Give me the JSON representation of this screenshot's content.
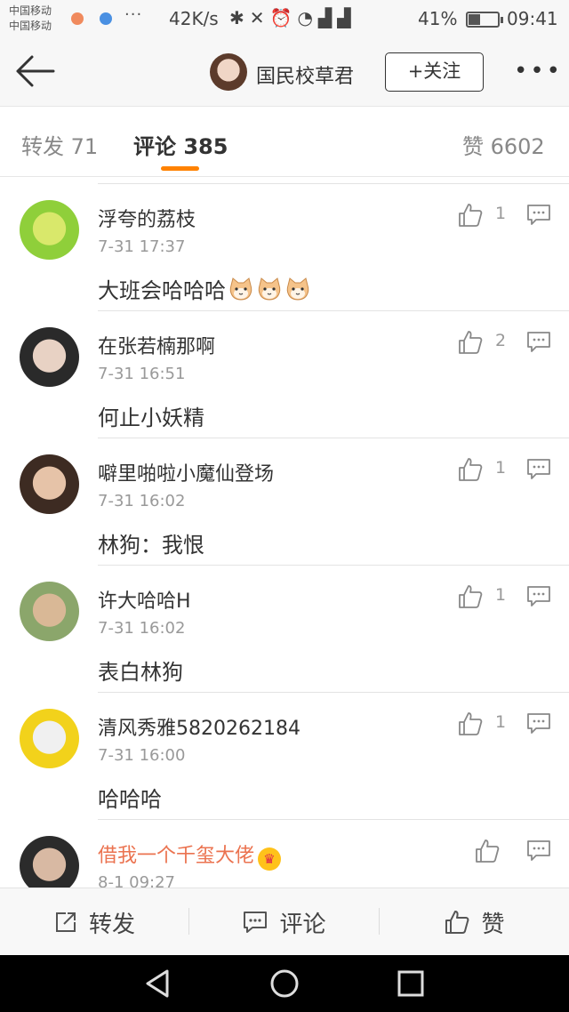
{
  "status_bar": {
    "carrier_1": "中国移动",
    "carrier_2": "中国移动",
    "more": "···",
    "net_speed": "42K/s",
    "icons": [
      "bluetooth-icon",
      "mute-icon",
      "alarm-icon",
      "wifi-icon",
      "signal-2g-icon",
      "signal-4g-icon"
    ],
    "battery_pct": "41%",
    "battery_level": 0.41,
    "time": "09:41"
  },
  "header": {
    "user_name": "国民校草君",
    "follow_label": "+关注",
    "more_label": "•••"
  },
  "tabs": {
    "reposts": "转发 71",
    "comments": "评论 385",
    "likes": "赞 6602"
  },
  "comments": [
    {
      "user": "浮夸的荔枝",
      "time": "7-31 17:37",
      "text": "大班会哈哈哈",
      "emoji_count": 3,
      "likes": "1",
      "vip": false,
      "avatar_colors": [
        "#8fcf3a",
        "#d9e86b"
      ]
    },
    {
      "user": "在张若楠那啊",
      "time": "7-31 16:51",
      "text": "何止小妖精",
      "emoji_count": 0,
      "likes": "2",
      "vip": false,
      "avatar_colors": [
        "#2a2a2a",
        "#e8d2c4"
      ]
    },
    {
      "user": "噼里啪啦小魔仙登场",
      "time": "7-31 16:02",
      "text": "林狗：我恨",
      "emoji_count": 0,
      "likes": "1",
      "vip": false,
      "avatar_colors": [
        "#3d2b22",
        "#e6c3a8"
      ]
    },
    {
      "user": "许大哈哈H",
      "time": "7-31 16:02",
      "text": "表白林狗",
      "emoji_count": 0,
      "likes": "1",
      "vip": false,
      "avatar_colors": [
        "#8ba66b",
        "#d9b896"
      ]
    },
    {
      "user": "清风秀雅5820262184",
      "time": "7-31 16:00",
      "text": "哈哈哈",
      "emoji_count": 0,
      "likes": "1",
      "vip": false,
      "avatar_colors": [
        "#f2d21b",
        "#f0f0f0"
      ]
    },
    {
      "user": "借我一个千玺大佬",
      "time": "8-1 09:27",
      "text": "",
      "emoji_count": 0,
      "likes": "",
      "vip": true,
      "avatar_colors": [
        "#2b2b2b",
        "#d8b9a3"
      ]
    }
  ],
  "actions": {
    "repost": "转发",
    "comment": "评论",
    "like": "赞"
  },
  "colors": {
    "accent": "#ff8200",
    "vip_name": "#eb7350",
    "secondary_text": "#999999"
  }
}
